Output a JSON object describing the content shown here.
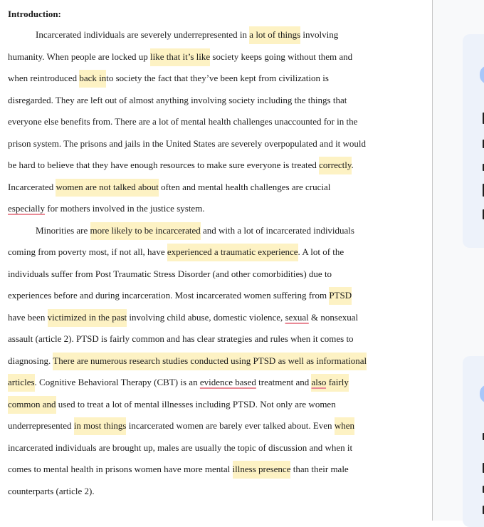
{
  "document": {
    "title": "Introduction:",
    "lines": [
      [
        {
          "t": "Incarcerated individuals are severely underrepresented in "
        },
        {
          "t": "a lot of things",
          "hl": true
        },
        {
          "t": " involving"
        }
      ],
      [
        {
          "t": "humanity. When people are locked up "
        },
        {
          "t": "like that it’s like",
          "hl": true
        },
        {
          "t": " society keeps going without them and"
        }
      ],
      [
        {
          "t": "when reintroduced "
        },
        {
          "t": "back in",
          "hl": true
        },
        {
          "t": "to society the fact that they’ve been kept from civilization is"
        }
      ],
      [
        {
          "t": "disregarded. They are left out of almost anything involving society including the things that"
        }
      ],
      [
        {
          "t": "everyone else benefits from. There are a lot of mental health challenges unaccounted for in the"
        }
      ],
      [
        {
          "t": "prison system. The prisons and jails in the United States are severely overpopulated and it would"
        }
      ],
      [
        {
          "t": "be hard to believe that they have enough resources to make sure everyone is treated "
        },
        {
          "t": "correctly",
          "hl": true
        },
        {
          "t": "."
        }
      ],
      [
        {
          "t": "Incarcerated "
        },
        {
          "t": "women are not talked about",
          "hl": true
        },
        {
          "t": " often and mental health challenges are crucial"
        }
      ],
      [
        {
          "t": "especially",
          "ul": true
        },
        {
          "t": " for mothers involved in the justice system."
        }
      ],
      [
        {
          "t": "Minorities are "
        },
        {
          "t": "more likely to be incarcerated",
          "hl": true
        },
        {
          "t": " and with a lot of incarcerated individuals"
        }
      ],
      [
        {
          "t": "coming from poverty most, if not all, have "
        },
        {
          "t": "experienced a traumatic experience",
          "hl": true
        },
        {
          "t": ". A lot of the"
        }
      ],
      [
        {
          "t": "individuals suffer from Post Traumatic Stress Disorder (and other comorbidities) due to"
        }
      ],
      [
        {
          "t": "experiences before and during incarceration. Most incarcerated women suffering from "
        },
        {
          "t": "PTSD",
          "hl": true
        }
      ],
      [
        {
          "t": "have been "
        },
        {
          "t": "victimized in the past",
          "hl": true
        },
        {
          "t": " involving child abuse, domestic violence, "
        },
        {
          "t": "sexual",
          "ul": true
        },
        {
          "t": " & nonsexual"
        }
      ],
      [
        {
          "t": "assault (article 2). PTSD is fairly common and has clear strategies and rules when it comes to"
        }
      ],
      [
        {
          "t": "diagnosing. "
        },
        {
          "t": "There are numerous research studies conducted using PTSD as well as informational",
          "hl": true
        }
      ],
      [
        {
          "t": "articles",
          "hl": true
        },
        {
          "t": ". Cognitive Behavioral Therapy (CBT) is an "
        },
        {
          "t": "evidence based",
          "ul": true
        },
        {
          "t": " treatment and "
        },
        {
          "t": "also",
          "hl": true,
          "ul": true
        },
        {
          "t": " fairly",
          "hl": true
        }
      ],
      [
        {
          "t": "common and",
          "hl": true
        },
        {
          "t": " used to treat a lot of mental illnesses including PTSD. Not only are women"
        }
      ],
      [
        {
          "t": "underrepresented "
        },
        {
          "t": "in most things",
          "hl": true
        },
        {
          "t": " incarcerated women are barely ever talked about. Even "
        },
        {
          "t": "when",
          "hl": true
        }
      ],
      [
        {
          "t": "incarcerated individuals are brought up, males are usually the topic of discussion and when it"
        }
      ],
      [
        {
          "t": "comes to mental health in prisons women have more mental "
        },
        {
          "t": "illness presence",
          "hl": true
        },
        {
          "t": " than their male"
        }
      ],
      [
        {
          "t": "counterparts (article 2)."
        }
      ]
    ],
    "indented_lines": [
      0,
      9
    ]
  },
  "side_panel": {
    "cards": [
      {
        "icon": "comment-card-icon"
      },
      {
        "icon": "comment-card-icon"
      }
    ]
  },
  "colors": {
    "highlight": "#fdf2c4",
    "underline": "#e98a96",
    "card_bg": "#edf2fa",
    "card_accent": "#a8c7fa"
  }
}
